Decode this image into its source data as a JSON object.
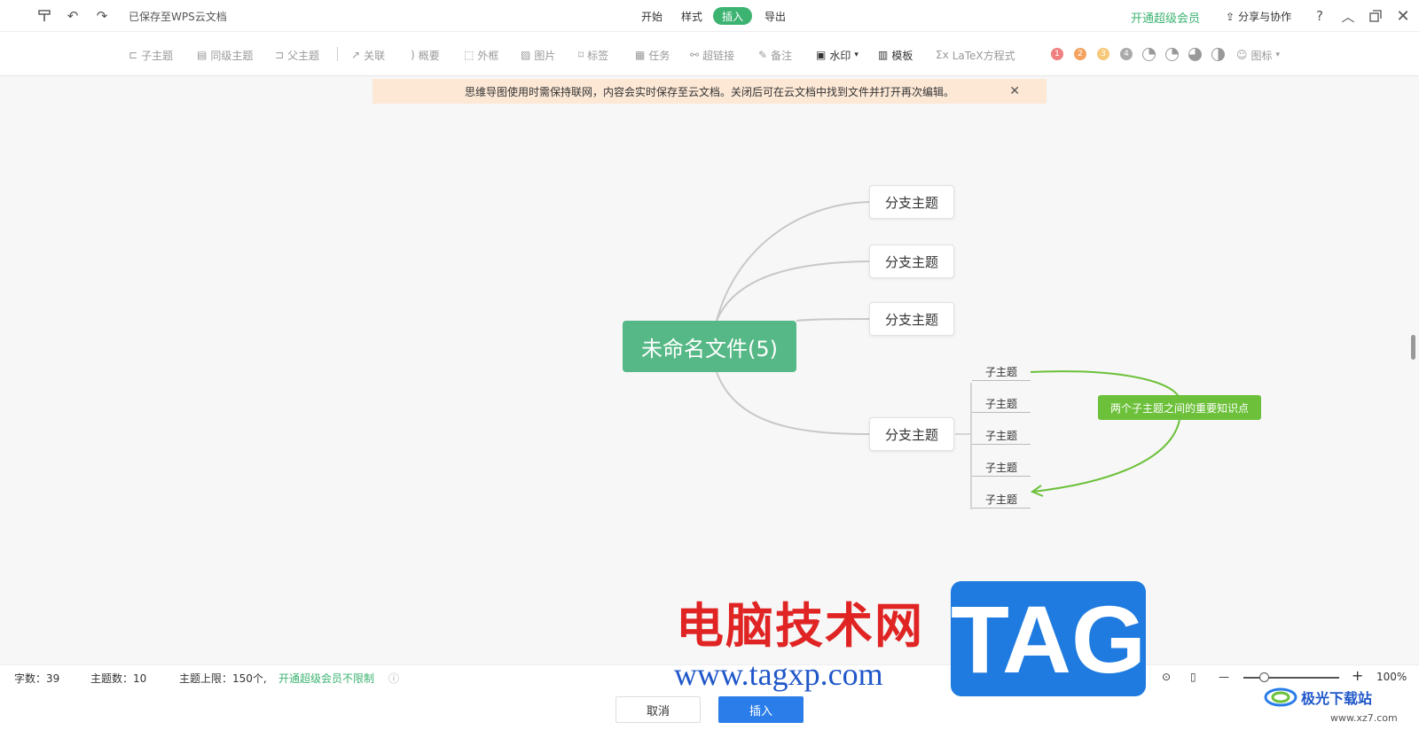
{
  "topbar": {
    "saved_status": "已保存至WPS云文档",
    "menus": [
      "开始",
      "样式",
      "插入",
      "导出"
    ],
    "active_menu": "插入",
    "vip_link": "开通超级会员",
    "share": "分享与协作"
  },
  "toolbar": {
    "items": {
      "subtopic": "子主题",
      "sibling": "同级主题",
      "parent": "父主题",
      "relation": "关联",
      "summary": "概要",
      "frame": "外框",
      "image": "图片",
      "tag": "标签",
      "task": "任务",
      "hyperlink": "超链接",
      "note": "备注",
      "watermark": "水印",
      "template": "模板",
      "latex": "LaTeX方程式",
      "icon": "图标"
    },
    "priorities": [
      "1",
      "2",
      "3",
      "4"
    ],
    "priority_colors": [
      "#f08080",
      "#f4a460",
      "#f6c87a",
      "#aaaaaa"
    ]
  },
  "notice": {
    "text": "思维导图使用时需保持联网，内容会实时保存至云文档。关闭后可在云文档中找到文件并打开再次编辑。"
  },
  "mindmap": {
    "central": "未命名文件(5)",
    "branches": [
      "分支主题",
      "分支主题",
      "分支主题",
      "分支主题"
    ],
    "subtopics": [
      "子主题",
      "子主题",
      "子主题",
      "子主题",
      "子主题"
    ],
    "relation_label": "两个子主题之间的重要知识点",
    "colors": {
      "central": "#56b886",
      "relation": "#6cc03a"
    }
  },
  "statusbar": {
    "word_count": "字数：39",
    "topic_count": "主题数：10",
    "topic_limit": "主题上限：150个,",
    "vip_unlimited": "开通超级会员不限制",
    "zoom": "100%"
  },
  "footer": {
    "cancel": "取消",
    "insert": "插入"
  },
  "watermark": {
    "cn": "电脑技术网",
    "url": "www.tagxp.com",
    "tag": "TAG",
    "jg_cn": "极光下载站",
    "jg_url": "www.xz7.com"
  }
}
